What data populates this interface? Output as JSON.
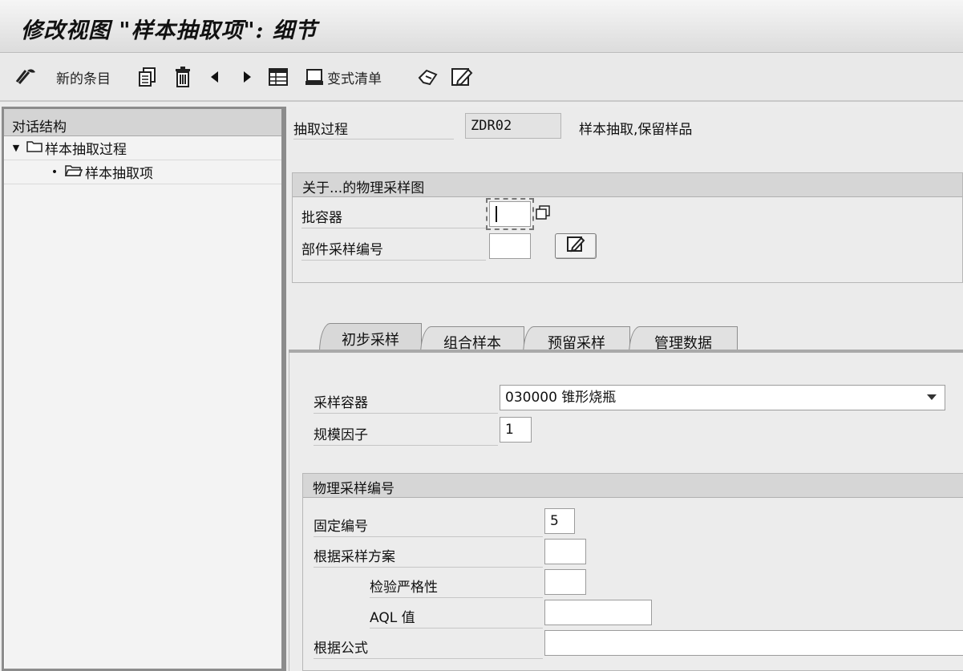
{
  "window": {
    "title": "修改视图 \"样本抽取项\": 细节"
  },
  "toolbar": {
    "new_entries_label": "新的条目",
    "variant_list_label": "变式清单"
  },
  "left_panel": {
    "header": "对话结构",
    "items": [
      {
        "label": "样本抽取过程",
        "expanded": true
      },
      {
        "label": "样本抽取项",
        "selected": true
      }
    ]
  },
  "form": {
    "process": {
      "label": "抽取过程",
      "value": "ZDR02",
      "description": "样本抽取,保留样品"
    },
    "physical_group": {
      "title": "关于...的物理采样图",
      "batch_container_label": "批容器",
      "batch_container_value": "",
      "part_sample_no_label": "部件采样编号",
      "part_sample_no_value": ""
    },
    "tabs": [
      {
        "label": "初步采样",
        "active": true
      },
      {
        "label": "组合样本",
        "active": false
      },
      {
        "label": "预留采样",
        "active": false
      },
      {
        "label": "管理数据",
        "active": false
      }
    ],
    "initial_sampling": {
      "container_label": "采样容器",
      "container_value": "030000 锥形烧瓶",
      "scale_factor_label": "规模因子",
      "scale_factor_value": "1",
      "numbering_group": {
        "title": "物理采样编号",
        "fixed_no_label": "固定编号",
        "fixed_no_value": "5",
        "by_plan_label": "根据采样方案",
        "by_plan_value": "",
        "severity_label": "检验严格性",
        "severity_value": "",
        "aql_label": "AQL 值",
        "aql_value": "",
        "by_formula_label": "根据公式",
        "by_formula_value": ""
      }
    }
  }
}
